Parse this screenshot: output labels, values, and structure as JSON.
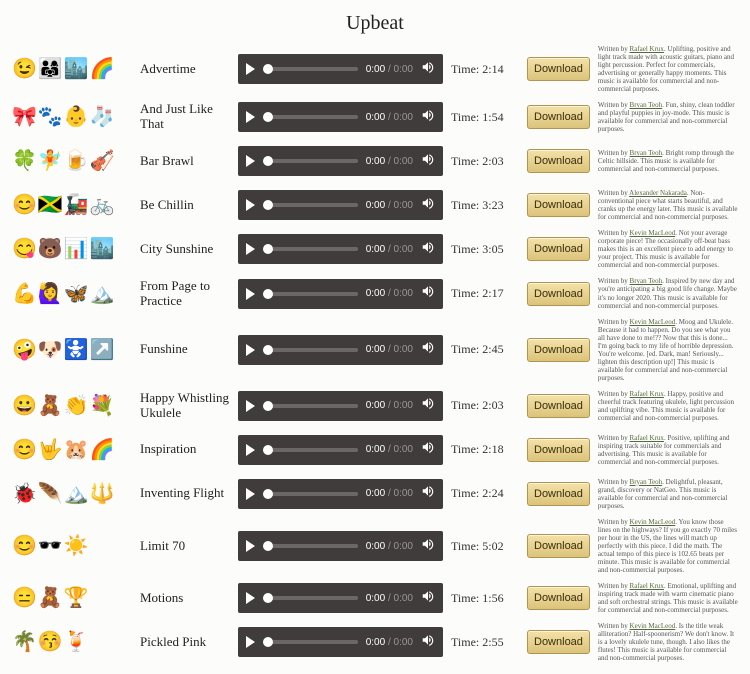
{
  "page_title": "Upbeat",
  "player": {
    "current": "0:00",
    "total": "0:00"
  },
  "time_label": "Time:",
  "download_label": "Download",
  "desc_prefix": "Written by ",
  "tracks": [
    {
      "emojis": "😉👨‍👩‍👧🏙️🌈",
      "title": "Advertime",
      "duration": "2:14",
      "author": "Rafael Krux",
      "desc": "Uplifting, positive and light track made with acoustic guitars, piano and light percussion. Perfect for commercials, advertising or generally happy moments. This music is available for commercial and non-commercial purposes."
    },
    {
      "emojis": "🎀🐾👶🧦",
      "title": "And Just Like That",
      "duration": "1:54",
      "author": "Bryan Teoh",
      "desc": "Fun, shiny, clean toddler and playful puppies in joy-mode. This music is available for commercial and non-commercial purposes."
    },
    {
      "emojis": "🍀🧚🍺🎻",
      "title": "Bar Brawl",
      "duration": "2:03",
      "author": "Bryan Teoh",
      "desc": "Bright romp through the Celtic hillside. This music is available for commercial and non-commercial purposes."
    },
    {
      "emojis": "😊🇯🇲🚂🚲",
      "title": "Be Chillin",
      "duration": "3:23",
      "author": "Alexander Nakarada",
      "desc": "Non-conventional piece what starts beautiful, and cranks up the energy later. This music is available for commercial and non-commercial purposes."
    },
    {
      "emojis": "😋🐻📊🏙️",
      "title": "City Sunshine",
      "duration": "3:05",
      "author": "Kevin MacLeod",
      "desc": "Not your average corporate piece! The occasionally off-beat bass makes this is an excellent piece to add energy to your project. This music is available for commercial and non-commercial purposes."
    },
    {
      "emojis": "💪🙋‍♀️🦋🏔️",
      "title": "From Page to Practice",
      "duration": "2:17",
      "author": "Bryan Teoh",
      "desc": "Inspired by new day and you're anticipating a big good life change. Maybe it's no longer 2020. This music is available for commercial and non-commercial purposes."
    },
    {
      "emojis": "🤪🐶🚼↗️",
      "title": "Funshine",
      "duration": "2:45",
      "author": "Kevin MacLeod",
      "desc": "Moog and Ukulele. Because it had to happen. Do you see what you all have done to me!?? Now that this is done... I'm going back to my life of horrible depression. You're welcome. [ed. Dark, man! Seriously... lighten this description up!] This music is available for commercial and non-commercial purposes."
    },
    {
      "emojis": "😀🧸👏💐",
      "title": "Happy Whistling Ukulele",
      "duration": "2:03",
      "author": "Rafael Krux",
      "desc": "Happy, positive and cheerful track featuring ukulele, light percussion and uplifting vibe. This music is available for commercial and non-commercial purposes."
    },
    {
      "emojis": "😊🤟🐹🌈",
      "title": "Inspiration",
      "duration": "2:18",
      "author": "Rafael Krux",
      "desc": "Positive, uplifting and inspiring track suitable for commercials and advertising. This music is available for commercial and non-commercial purposes."
    },
    {
      "emojis": "🐞🪶🏔️🔱",
      "title": "Inventing Flight",
      "duration": "2:24",
      "author": "Bryan Teoh",
      "desc": "Delightful, pleasant, grand, discovery or NatGeo. This music is available for commercial and non-commercial purposes."
    },
    {
      "emojis": "😊🕶️☀️",
      "title": "Limit 70",
      "duration": "5:02",
      "author": "Kevin MacLeod",
      "desc": "You know those lines on the highways? If you go exactly 70 miles per hour in the US, the lines will match up perfectly with this piece. I did the math. The actual tempo of this piece is 102.65 beats per minute. This music is available for commercial and non-commercial purposes."
    },
    {
      "emojis": "😑🧸🏆",
      "title": "Motions",
      "duration": "1:56",
      "author": "Rafael Krux",
      "desc": "Emotional, uplifting and inspiring track made with warm cinematic piano and soft orchestral strings. This music is available for commercial and non-commercial purposes."
    },
    {
      "emojis": "🌴😚🍹",
      "title": "Pickled Pink",
      "duration": "2:55",
      "author": "Kevin MacLeod",
      "desc": "Is the title weak alliteration? Half-spoonerism? We don't know. It is a lovely ukulele tune, though. I also likes the flutes! This music is available for commercial and non-commercial purposes."
    }
  ]
}
